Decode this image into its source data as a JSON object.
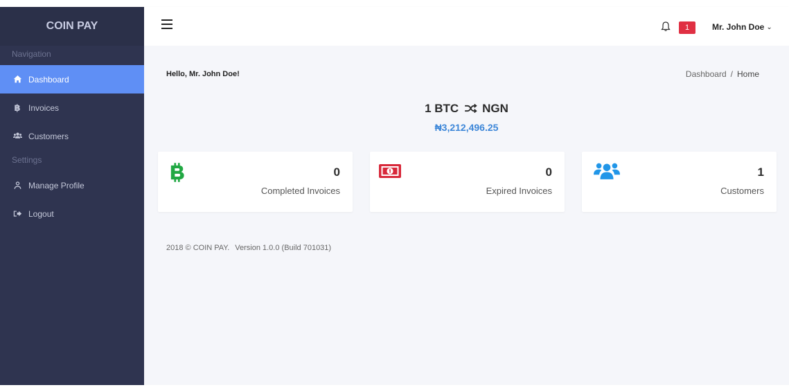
{
  "sidebar": {
    "brand": "COIN PAY",
    "sections": [
      {
        "label": "Navigation"
      },
      {
        "label": "Settings"
      }
    ],
    "items": [
      {
        "label": "Dashboard",
        "icon": "home-icon",
        "active": true
      },
      {
        "label": "Invoices",
        "icon": "bitcoin-icon",
        "icon_glyph": "฿"
      },
      {
        "label": "Customers",
        "icon": "users-icon"
      },
      {
        "label": "Manage Profile",
        "icon": "user-icon"
      },
      {
        "label": "Logout",
        "icon": "sign-out-icon"
      }
    ]
  },
  "topbar": {
    "notification_count": "1",
    "user_name": "Mr. John Doe"
  },
  "main": {
    "greeting": "Hello, Mr. John Doe!",
    "breadcrumb": [
      "Dashboard",
      "Home"
    ],
    "rate": {
      "from": "1 BTC",
      "to": "NGN",
      "value": "₦3,212,496.25"
    },
    "cards": [
      {
        "value": "0",
        "label": "Completed Invoices",
        "icon": "bitcoin-icon",
        "color": "#21a843"
      },
      {
        "value": "0",
        "label": "Expired Invoices",
        "icon": "money-icon",
        "color": "#d8283a"
      },
      {
        "value": "1",
        "label": "Customers",
        "icon": "users-icon",
        "color": "#2196e8"
      }
    ],
    "footer": {
      "copyright": "2018 © COIN PAY.",
      "version": "Version 1.0.0 (Build 701031)"
    }
  },
  "colors": {
    "sidebar_bg": "#2f3450",
    "active_item": "#5f8ff5",
    "badge": "#e03043",
    "rate_value": "#3c86d8"
  }
}
